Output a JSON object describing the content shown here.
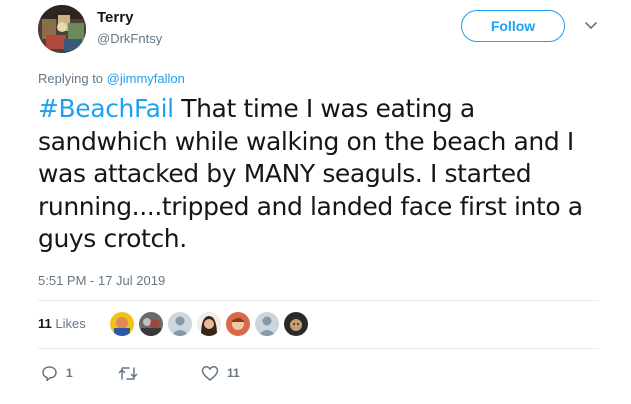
{
  "user": {
    "name": "Terry",
    "handle": "@DrkFntsy"
  },
  "follow_label": "Follow",
  "reply": {
    "prefix": "Replying to ",
    "mention": "@jimmyfallon"
  },
  "tweet": {
    "hashtag": "#BeachFail",
    "text": " That time I was eating a sandwhich while walking on the beach and I was attacked by MANY seaguls. I started running....tripped and landed face first into a guys crotch."
  },
  "timestamp": "5:51 PM - 17 Jul 2019",
  "likes": {
    "count": "11",
    "label": "Likes"
  },
  "actions": {
    "reply_count": "1",
    "retweet_count": "",
    "like_count": "11"
  },
  "colors": {
    "accent": "#1da1f2",
    "secondary_text": "#657786",
    "divider": "#e6ecf0"
  }
}
